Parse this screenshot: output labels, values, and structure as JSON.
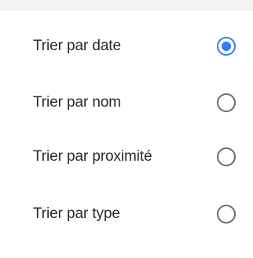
{
  "sort_menu": {
    "items": [
      {
        "label": "Trier par date",
        "selected": true
      },
      {
        "label": "Trier par nom",
        "selected": false
      },
      {
        "label": "Trier par proximité",
        "selected": false
      },
      {
        "label": "Trier par type",
        "selected": false
      }
    ]
  },
  "colors": {
    "accent": "#2f7cf6",
    "radio_unselected": "#6b6b6b",
    "text": "#2a2a2a",
    "top_strip": "#f4f4f4"
  }
}
